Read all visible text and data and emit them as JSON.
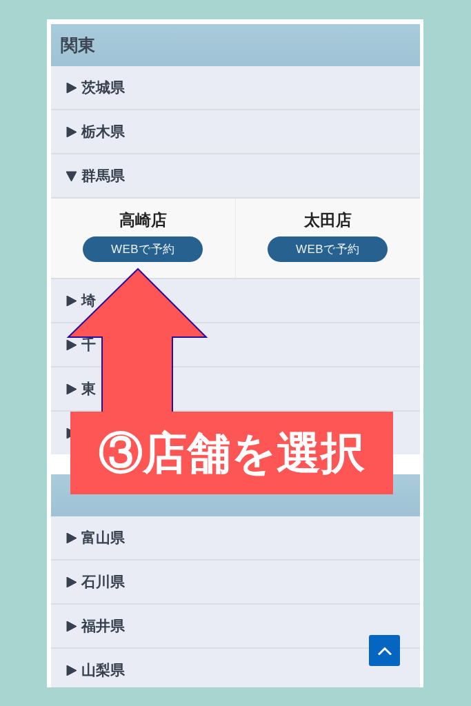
{
  "regions": [
    {
      "title": "関東",
      "prefectures": [
        {
          "name": "茨城県",
          "expanded": false
        },
        {
          "name": "栃木県",
          "expanded": false
        },
        {
          "name": "群馬県",
          "expanded": true,
          "stores": [
            {
              "name": "高崎店",
              "button": "WEBで予約"
            },
            {
              "name": "太田店",
              "button": "WEBで予約"
            }
          ]
        },
        {
          "name": "埼",
          "expanded": false
        },
        {
          "name": "千",
          "expanded": false
        },
        {
          "name": "東",
          "expanded": false
        },
        {
          "expanded": false
        }
      ]
    },
    {
      "prefectures": [
        {
          "name": "富山県",
          "expanded": false
        },
        {
          "name": "石川県",
          "expanded": false
        },
        {
          "name": "福井県",
          "expanded": false
        },
        {
          "name": "山梨県",
          "expanded": false
        }
      ]
    }
  ],
  "annotation": {
    "label": "③店舗を選択"
  },
  "back_to_top": true
}
